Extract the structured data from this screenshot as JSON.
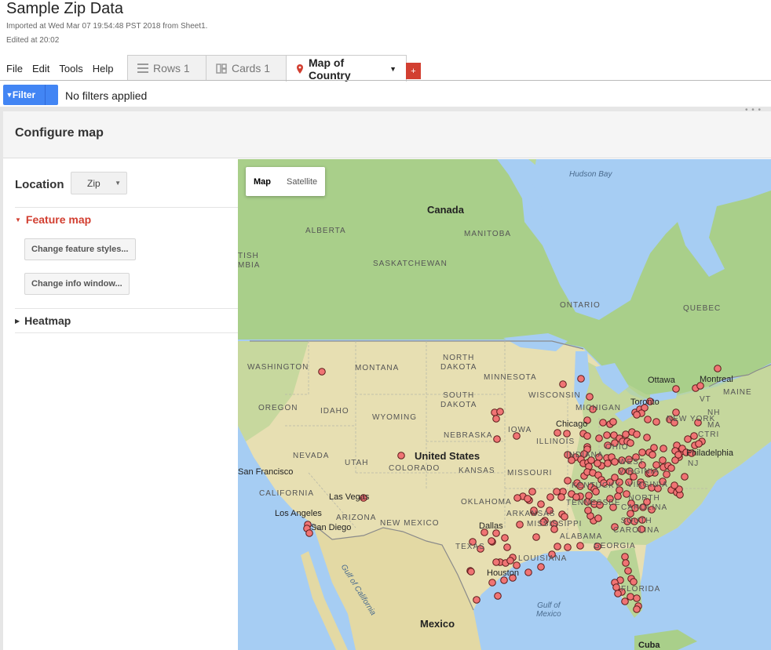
{
  "doc": {
    "title": "Sample Zip Data",
    "imported": "Imported at Wed Mar 07 19:54:48 PST 2018 from Sheet1.",
    "edited": "Edited at 20:02"
  },
  "menu": [
    {
      "label": "File"
    },
    {
      "label": "Edit"
    },
    {
      "label": "Tools"
    },
    {
      "label": "Help"
    }
  ],
  "tabs": {
    "rows": "Rows 1",
    "cards": "Cards 1",
    "map": "Map of Country",
    "add": "+"
  },
  "filter": {
    "button": "Filter",
    "status": "No filters applied"
  },
  "config": {
    "title": "Configure map",
    "location_label": "Location",
    "location_value": "Zip",
    "feature_map": "Feature map",
    "change_styles": "Change feature styles...",
    "change_info": "Change info window...",
    "heatmap": "Heatmap"
  },
  "map": {
    "type_map": "Map",
    "type_satellite": "Satellite",
    "labels": {
      "hudson_bay": "Hudson Bay",
      "canada": "Canada",
      "alberta": "ALBERTA",
      "manitoba": "MANITOBA",
      "bc": "TISH\nMBIA",
      "saskatchewan": "SASKATCHEWAN",
      "ontario": "ONTARIO",
      "quebec": "QUEBEC",
      "washington": "WASHINGTON",
      "montana": "MONTANA",
      "north_dakota": "NORTH\nDAKOTA",
      "minnesota": "MINNESOTA",
      "ottawa": "Ottawa",
      "montreal": "Montreal",
      "maine": "MAINE",
      "vt": "VT",
      "oregon": "OREGON",
      "idaho": "IDAHO",
      "south_dakota": "SOUTH\nDAKOTA",
      "wisconsin": "WISCONSIN",
      "michigan": "MICHIGAN",
      "toronto": "Toronto",
      "new_york": "NEW YORK",
      "nh": "NH",
      "ma": "MA",
      "wyoming": "WYOMING",
      "iowa": "IOWA",
      "chicago": "Chicago",
      "ct": "CTRI",
      "nebraska": "NEBRASKA",
      "illinois": "ILLINOIS",
      "ohio": "OHIO",
      "nevada": "NEVADA",
      "utah": "UTAH",
      "united_states": "United States",
      "indiana": "INDIANA",
      "philadelphia": "Philadelphia",
      "colorado": "COLORADO",
      "kansas": "KANSAS",
      "san_francisco": "San Francisco",
      "missouri": "MISSOURI",
      "west_virginia": "WEST\nVIRGINIA",
      "nj": "NJ",
      "kentucky": "KENTUCKY",
      "virginia": "VIRGINIA",
      "california": "CALIFORNIA",
      "las_vegas": "Las Vegas",
      "oklahoma": "OKLAHOMA",
      "tennessee": "TENNESSEE",
      "north_carolina": "NORTH\nCAROLINA",
      "los_angeles": "Los Angeles",
      "arizona": "ARIZONA",
      "new_mexico": "NEW MEXICO",
      "arkansas": "ARKANSAS",
      "san_diego": "San Diego",
      "dallas": "Dallas",
      "mississippi": "MISSISSIPPI",
      "south_carolina": "SOUTH\nCAROLINA",
      "alabama": "ALABAMA",
      "georgia": "GEORGIA",
      "texas": "TEXAS",
      "louisiana": "LOUISIANA",
      "houston": "Houston",
      "florida": "FLORIDA",
      "gulf_of_california": "Gulf of California",
      "gulf_of_mexico": "Gulf of\nMexico",
      "mexico": "Mexico",
      "cuba": "Cuba"
    }
  },
  "colors": {
    "accent_red": "#d23f31",
    "filter_blue": "#4285f4",
    "marker_fill": "#f07474",
    "water": "#a6cdf3",
    "land_north": "#a9cf8a",
    "land_south": "#e7dfb2"
  },
  "markers": {
    "count_description": "zip code point markers across the US",
    "icon": "map-marker-dot"
  }
}
